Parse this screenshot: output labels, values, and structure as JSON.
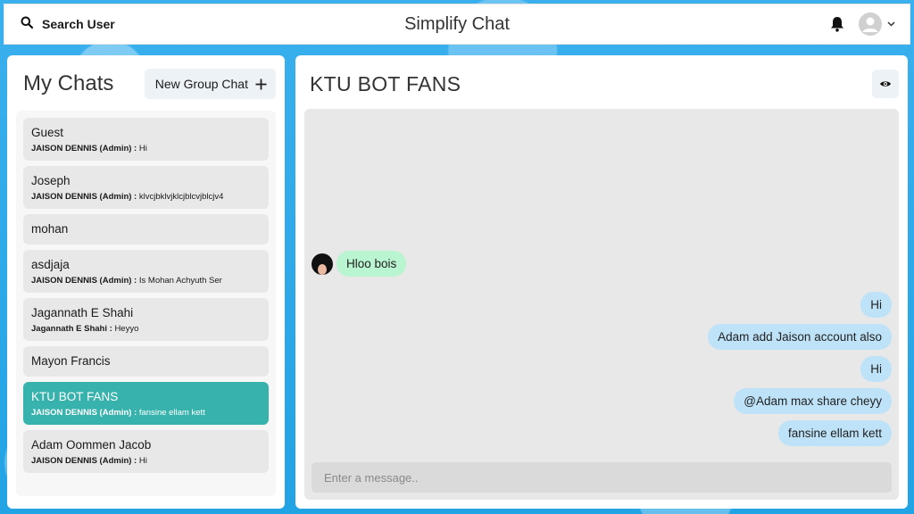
{
  "topbar": {
    "search_label": "Search User",
    "app_title": "Simplify Chat",
    "icons": {
      "search": "search-icon",
      "bell": "bell-icon",
      "avatar": "user-avatar",
      "chevron": "chevron-down-icon"
    }
  },
  "chats_panel": {
    "title": "My Chats",
    "new_group_label": "New Group Chat",
    "chats": [
      {
        "name": "Guest",
        "sender": "JAISON DENNIS (Admin) :",
        "latest": "Hi",
        "active": false
      },
      {
        "name": "Joseph",
        "sender": "JAISON DENNIS (Admin) :",
        "latest": "klvcjbklvjklcjblcvjblcjv4",
        "active": false
      },
      {
        "name": "mohan",
        "sender": "",
        "latest": "",
        "active": false
      },
      {
        "name": "asdjaja",
        "sender": "JAISON DENNIS (Admin) :",
        "latest": "Is Mohan Achyuth Ser",
        "active": false
      },
      {
        "name": "Jagannath E Shahi",
        "sender": "Jagannath E Shahi :",
        "latest": "Heyyo",
        "active": false
      },
      {
        "name": "Mayon Francis",
        "sender": "",
        "latest": "",
        "active": false
      },
      {
        "name": "KTU BOT FANS",
        "sender": "JAISON DENNIS (Admin) :",
        "latest": "fansine ellam kett",
        "active": true
      },
      {
        "name": "Adam Oommen Jacob",
        "sender": "JAISON DENNIS (Admin) :",
        "latest": "Hi",
        "active": false
      }
    ]
  },
  "chat_window": {
    "title": "KTU BOT FANS",
    "messages": [
      {
        "text": "Hloo bois",
        "side": "left"
      },
      {
        "text": "Hi",
        "side": "right"
      },
      {
        "text": "Adam add Jaison account also",
        "side": "right"
      },
      {
        "text": "Hi",
        "side": "right"
      },
      {
        "text": "@Adam max share cheyy",
        "side": "right"
      },
      {
        "text": "fansine ellam kett",
        "side": "right"
      }
    ],
    "input_placeholder": "Enter a message.."
  },
  "colors": {
    "active_chat": "#38b2ac",
    "sent_bubble": "#bee3f8",
    "received_bubble": "#b9f5d0"
  }
}
